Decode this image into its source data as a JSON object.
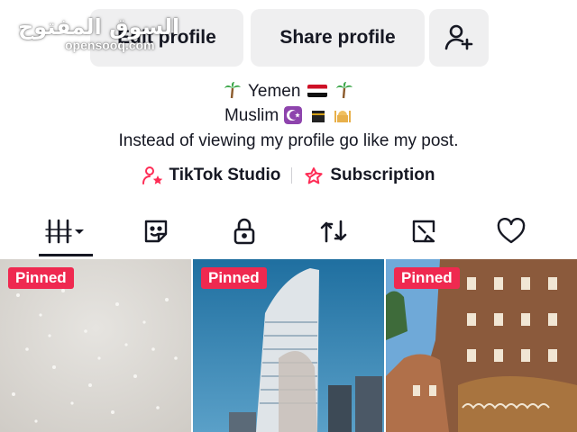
{
  "header": {
    "edit_label": "Edit profile",
    "share_label": "Share profile",
    "add_friend_icon": "add-user-icon"
  },
  "watermark": {
    "arabic": "السوق المفتوح",
    "latin": "opensooq.com"
  },
  "bio": {
    "line1": "Yemen",
    "line2": "Muslim",
    "line3": "Instead of viewing my profile go like my post."
  },
  "links": {
    "studio_label": "TikTok Studio",
    "subscription_label": "Subscription",
    "accent": "#fe2c55"
  },
  "tabs": [
    {
      "icon": "videos-grid-icon",
      "active": true
    },
    {
      "icon": "sticker-icon"
    },
    {
      "icon": "lock-icon"
    },
    {
      "icon": "repost-icon"
    },
    {
      "icon": "tagged-icon"
    },
    {
      "icon": "heart-icon"
    }
  ],
  "videos": [
    {
      "badge": "Pinned"
    },
    {
      "badge": "Pinned"
    },
    {
      "badge": "Pinned"
    }
  ],
  "colors": {
    "badge": "#ef2950",
    "button_bg": "#efeff0",
    "text": "#161823"
  }
}
